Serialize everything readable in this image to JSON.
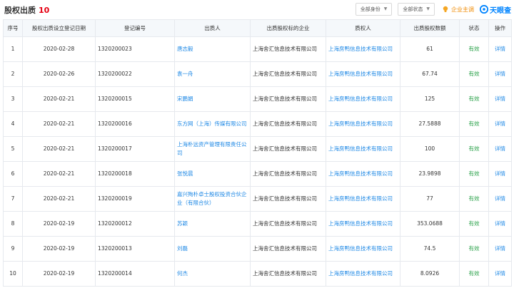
{
  "header": {
    "title": "股权出质",
    "count": "10",
    "filter_identity": "全部身份",
    "filter_status": "全部状态",
    "company_host": "企业主调",
    "logo_text": "天眼查"
  },
  "table": {
    "columns": [
      "序号",
      "股权出质设立登记日期",
      "登记编号",
      "出质人",
      "出质股权标的企业",
      "质权人",
      "出质股权数额",
      "状态",
      "操作"
    ],
    "rows": [
      {
        "no": "1",
        "date": "2020-02-28",
        "reg": "1320200023",
        "pledgor": "唐志毅",
        "target": "上海舍汇信息技术有限公司",
        "pledgee": "上海房鸭信息技术有限公司",
        "amount": "61",
        "status": "有效",
        "action": "详情"
      },
      {
        "no": "2",
        "date": "2020-02-26",
        "reg": "1320200022",
        "pledgor": "袁一舟",
        "target": "上海舍汇信息技术有限公司",
        "pledgee": "上海房鸭信息技术有限公司",
        "amount": "67.74",
        "status": "有效",
        "action": "详情"
      },
      {
        "no": "3",
        "date": "2020-02-21",
        "reg": "1320200015",
        "pledgor": "宋鹏娟",
        "target": "上海舍汇信息技术有限公司",
        "pledgee": "上海房鸭信息技术有限公司",
        "amount": "125",
        "status": "有效",
        "action": "详情"
      },
      {
        "no": "4",
        "date": "2020-02-21",
        "reg": "1320200016",
        "pledgor": "东方网（上海）传媒有限公司",
        "target": "上海舍汇信息技术有限公司",
        "pledgee": "上海房鸭信息技术有限公司",
        "amount": "27.5888",
        "status": "有效",
        "action": "详情"
      },
      {
        "no": "5",
        "date": "2020-02-21",
        "reg": "1320200017",
        "pledgor": "上海朴远资产管理有限责任公司",
        "target": "上海舍汇信息技术有限公司",
        "pledgee": "上海房鸭信息技术有限公司",
        "amount": "100",
        "status": "有效",
        "action": "详情"
      },
      {
        "no": "6",
        "date": "2020-02-21",
        "reg": "1320200018",
        "pledgor": "张悦晨",
        "target": "上海舍汇信息技术有限公司",
        "pledgee": "上海房鸭信息技术有限公司",
        "amount": "23.9898",
        "status": "有效",
        "action": "详情"
      },
      {
        "no": "7",
        "date": "2020-02-21",
        "reg": "1320200019",
        "pledgor": "嘉兴殉朴卓士股权投资合伙企业（有限合伙）",
        "target": "上海舍汇信息技术有限公司",
        "pledgee": "上海房鸭信息技术有限公司",
        "amount": "77",
        "status": "有效",
        "action": "详情"
      },
      {
        "no": "8",
        "date": "2020-02-19",
        "reg": "1320200012",
        "pledgor": "苏颖",
        "target": "上海舍汇信息技术有限公司",
        "pledgee": "上海房鸭信息技术有限公司",
        "amount": "353.0688",
        "status": "有效",
        "action": "详情"
      },
      {
        "no": "9",
        "date": "2020-02-19",
        "reg": "1320200013",
        "pledgor": "刘磊",
        "target": "上海舍汇信息技术有限公司",
        "pledgee": "上海房鸭信息技术有限公司",
        "amount": "74.5",
        "status": "有效",
        "action": "详情"
      },
      {
        "no": "10",
        "date": "2020-02-19",
        "reg": "1320200014",
        "pledgor": "何杰",
        "target": "上海舍汇信息技术有限公司",
        "pledgee": "上海房鸭信息技术有限公司",
        "amount": "8.0926",
        "status": "有效",
        "action": "详情"
      }
    ]
  }
}
